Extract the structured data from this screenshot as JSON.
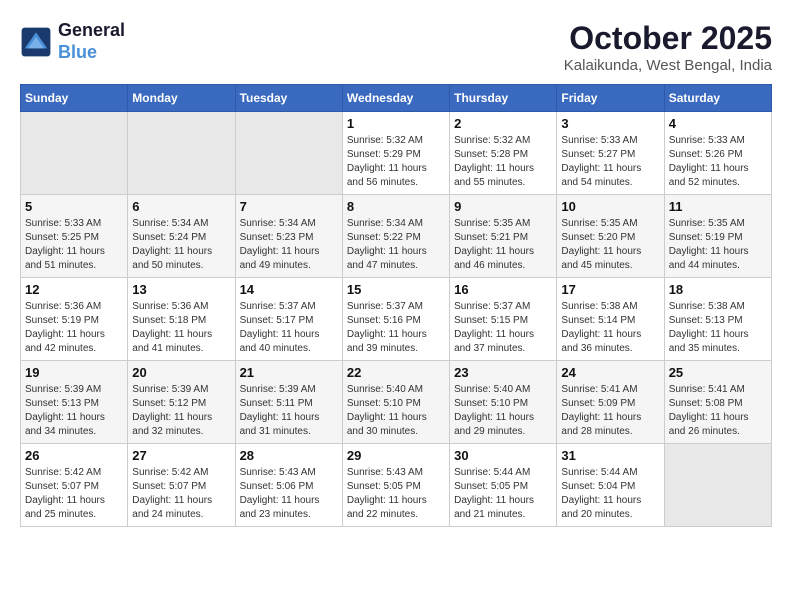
{
  "header": {
    "logo_line1": "General",
    "logo_line2": "Blue",
    "month": "October 2025",
    "location": "Kalaikunda, West Bengal, India"
  },
  "weekdays": [
    "Sunday",
    "Monday",
    "Tuesday",
    "Wednesday",
    "Thursday",
    "Friday",
    "Saturday"
  ],
  "weeks": [
    [
      {
        "day": "",
        "sunrise": "",
        "sunset": "",
        "daylight": ""
      },
      {
        "day": "",
        "sunrise": "",
        "sunset": "",
        "daylight": ""
      },
      {
        "day": "",
        "sunrise": "",
        "sunset": "",
        "daylight": ""
      },
      {
        "day": "1",
        "sunrise": "Sunrise: 5:32 AM",
        "sunset": "Sunset: 5:29 PM",
        "daylight": "Daylight: 11 hours and 56 minutes."
      },
      {
        "day": "2",
        "sunrise": "Sunrise: 5:32 AM",
        "sunset": "Sunset: 5:28 PM",
        "daylight": "Daylight: 11 hours and 55 minutes."
      },
      {
        "day": "3",
        "sunrise": "Sunrise: 5:33 AM",
        "sunset": "Sunset: 5:27 PM",
        "daylight": "Daylight: 11 hours and 54 minutes."
      },
      {
        "day": "4",
        "sunrise": "Sunrise: 5:33 AM",
        "sunset": "Sunset: 5:26 PM",
        "daylight": "Daylight: 11 hours and 52 minutes."
      }
    ],
    [
      {
        "day": "5",
        "sunrise": "Sunrise: 5:33 AM",
        "sunset": "Sunset: 5:25 PM",
        "daylight": "Daylight: 11 hours and 51 minutes."
      },
      {
        "day": "6",
        "sunrise": "Sunrise: 5:34 AM",
        "sunset": "Sunset: 5:24 PM",
        "daylight": "Daylight: 11 hours and 50 minutes."
      },
      {
        "day": "7",
        "sunrise": "Sunrise: 5:34 AM",
        "sunset": "Sunset: 5:23 PM",
        "daylight": "Daylight: 11 hours and 49 minutes."
      },
      {
        "day": "8",
        "sunrise": "Sunrise: 5:34 AM",
        "sunset": "Sunset: 5:22 PM",
        "daylight": "Daylight: 11 hours and 47 minutes."
      },
      {
        "day": "9",
        "sunrise": "Sunrise: 5:35 AM",
        "sunset": "Sunset: 5:21 PM",
        "daylight": "Daylight: 11 hours and 46 minutes."
      },
      {
        "day": "10",
        "sunrise": "Sunrise: 5:35 AM",
        "sunset": "Sunset: 5:20 PM",
        "daylight": "Daylight: 11 hours and 45 minutes."
      },
      {
        "day": "11",
        "sunrise": "Sunrise: 5:35 AM",
        "sunset": "Sunset: 5:19 PM",
        "daylight": "Daylight: 11 hours and 44 minutes."
      }
    ],
    [
      {
        "day": "12",
        "sunrise": "Sunrise: 5:36 AM",
        "sunset": "Sunset: 5:19 PM",
        "daylight": "Daylight: 11 hours and 42 minutes."
      },
      {
        "day": "13",
        "sunrise": "Sunrise: 5:36 AM",
        "sunset": "Sunset: 5:18 PM",
        "daylight": "Daylight: 11 hours and 41 minutes."
      },
      {
        "day": "14",
        "sunrise": "Sunrise: 5:37 AM",
        "sunset": "Sunset: 5:17 PM",
        "daylight": "Daylight: 11 hours and 40 minutes."
      },
      {
        "day": "15",
        "sunrise": "Sunrise: 5:37 AM",
        "sunset": "Sunset: 5:16 PM",
        "daylight": "Daylight: 11 hours and 39 minutes."
      },
      {
        "day": "16",
        "sunrise": "Sunrise: 5:37 AM",
        "sunset": "Sunset: 5:15 PM",
        "daylight": "Daylight: 11 hours and 37 minutes."
      },
      {
        "day": "17",
        "sunrise": "Sunrise: 5:38 AM",
        "sunset": "Sunset: 5:14 PM",
        "daylight": "Daylight: 11 hours and 36 minutes."
      },
      {
        "day": "18",
        "sunrise": "Sunrise: 5:38 AM",
        "sunset": "Sunset: 5:13 PM",
        "daylight": "Daylight: 11 hours and 35 minutes."
      }
    ],
    [
      {
        "day": "19",
        "sunrise": "Sunrise: 5:39 AM",
        "sunset": "Sunset: 5:13 PM",
        "daylight": "Daylight: 11 hours and 34 minutes."
      },
      {
        "day": "20",
        "sunrise": "Sunrise: 5:39 AM",
        "sunset": "Sunset: 5:12 PM",
        "daylight": "Daylight: 11 hours and 32 minutes."
      },
      {
        "day": "21",
        "sunrise": "Sunrise: 5:39 AM",
        "sunset": "Sunset: 5:11 PM",
        "daylight": "Daylight: 11 hours and 31 minutes."
      },
      {
        "day": "22",
        "sunrise": "Sunrise: 5:40 AM",
        "sunset": "Sunset: 5:10 PM",
        "daylight": "Daylight: 11 hours and 30 minutes."
      },
      {
        "day": "23",
        "sunrise": "Sunrise: 5:40 AM",
        "sunset": "Sunset: 5:10 PM",
        "daylight": "Daylight: 11 hours and 29 minutes."
      },
      {
        "day": "24",
        "sunrise": "Sunrise: 5:41 AM",
        "sunset": "Sunset: 5:09 PM",
        "daylight": "Daylight: 11 hours and 28 minutes."
      },
      {
        "day": "25",
        "sunrise": "Sunrise: 5:41 AM",
        "sunset": "Sunset: 5:08 PM",
        "daylight": "Daylight: 11 hours and 26 minutes."
      }
    ],
    [
      {
        "day": "26",
        "sunrise": "Sunrise: 5:42 AM",
        "sunset": "Sunset: 5:07 PM",
        "daylight": "Daylight: 11 hours and 25 minutes."
      },
      {
        "day": "27",
        "sunrise": "Sunrise: 5:42 AM",
        "sunset": "Sunset: 5:07 PM",
        "daylight": "Daylight: 11 hours and 24 minutes."
      },
      {
        "day": "28",
        "sunrise": "Sunrise: 5:43 AM",
        "sunset": "Sunset: 5:06 PM",
        "daylight": "Daylight: 11 hours and 23 minutes."
      },
      {
        "day": "29",
        "sunrise": "Sunrise: 5:43 AM",
        "sunset": "Sunset: 5:05 PM",
        "daylight": "Daylight: 11 hours and 22 minutes."
      },
      {
        "day": "30",
        "sunrise": "Sunrise: 5:44 AM",
        "sunset": "Sunset: 5:05 PM",
        "daylight": "Daylight: 11 hours and 21 minutes."
      },
      {
        "day": "31",
        "sunrise": "Sunrise: 5:44 AM",
        "sunset": "Sunset: 5:04 PM",
        "daylight": "Daylight: 11 hours and 20 minutes."
      },
      {
        "day": "",
        "sunrise": "",
        "sunset": "",
        "daylight": ""
      }
    ]
  ]
}
